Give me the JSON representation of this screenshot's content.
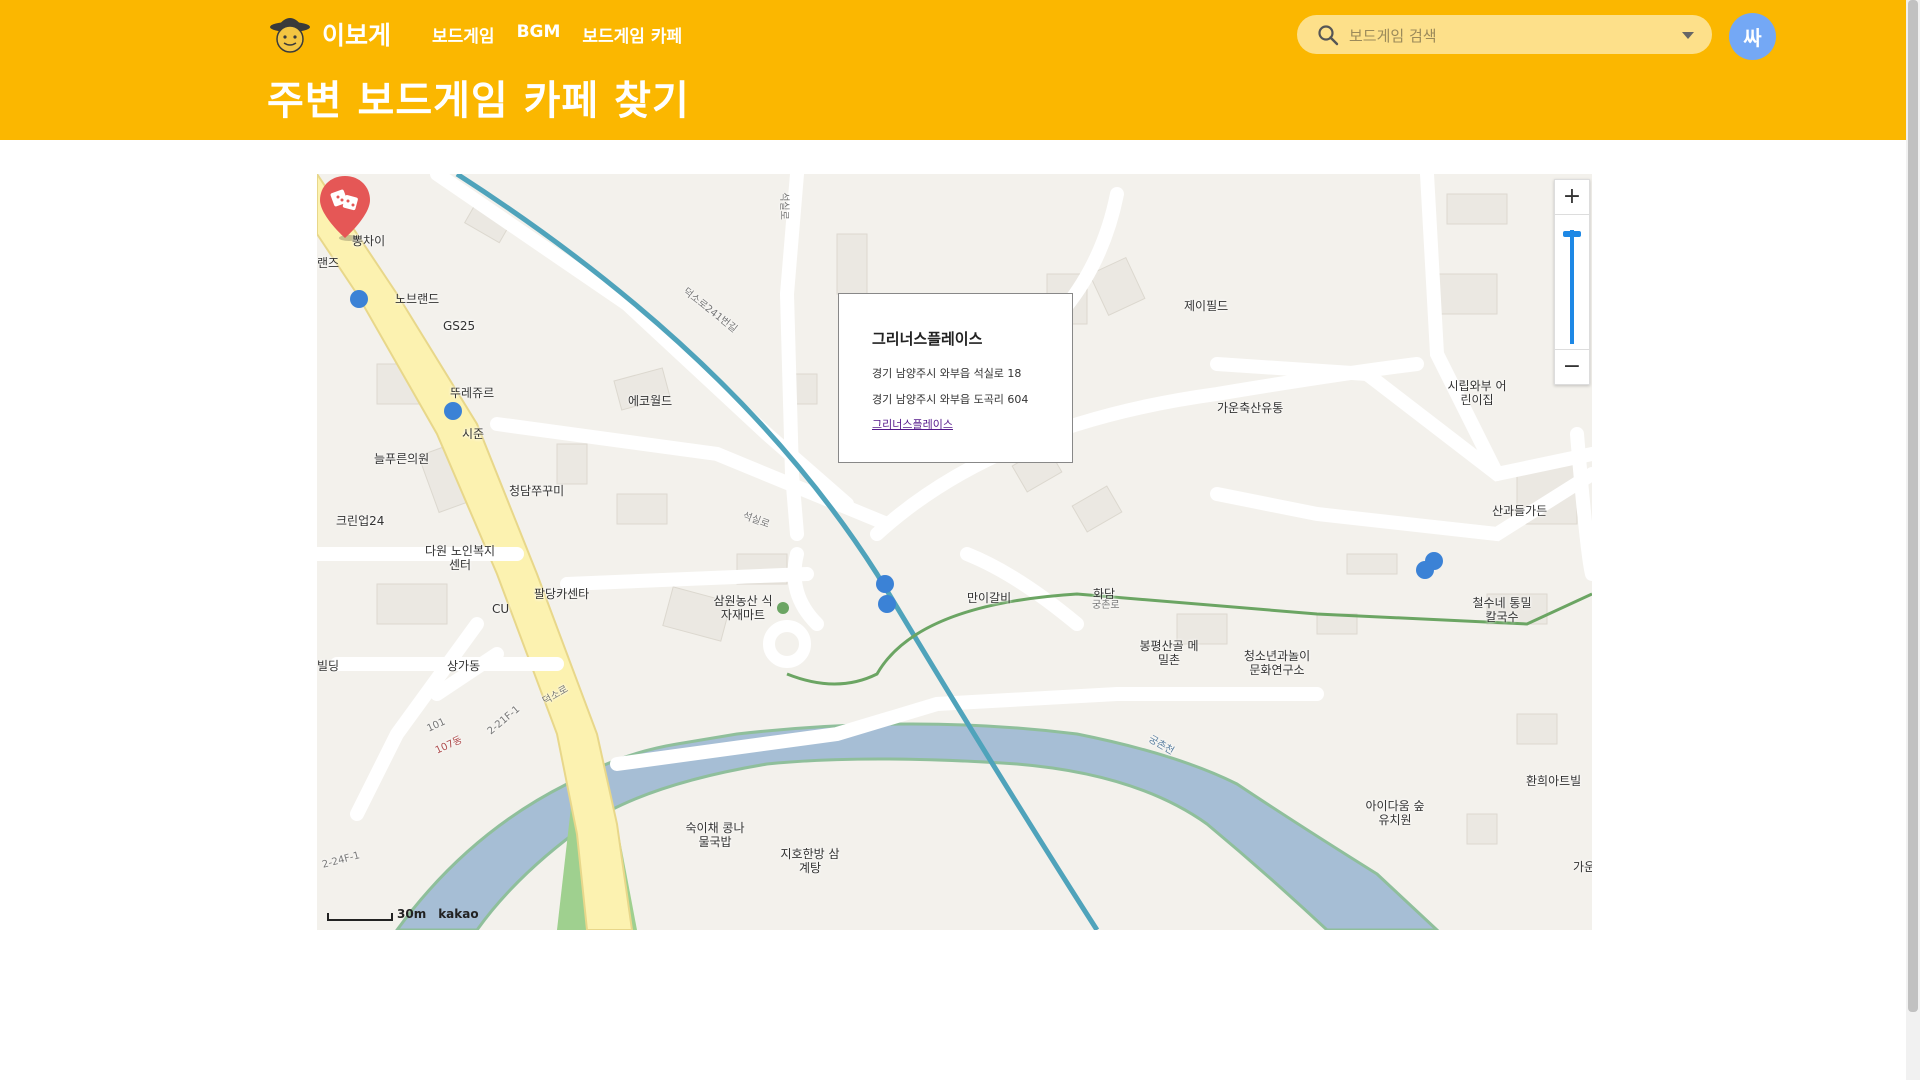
{
  "header": {
    "logo_text": "이보게",
    "nav": [
      "보드게임",
      "BGM",
      "보드게임 카페"
    ],
    "page_title": "주변 보드게임 카페 찾기",
    "search_placeholder": "보드게임 검색",
    "avatar_letter": "싸",
    "bg_color": "#fbb700"
  },
  "map": {
    "popup": {
      "name": "그리너스플레이스",
      "road_address": "경기 남양주시 와부읍 석실로 18",
      "jibun_address": "경기 남양주시 와부읍 도곡리 604",
      "link_text": "그리너스플레이스"
    },
    "zoom_in": "+",
    "zoom_out": "−",
    "scale_label": "30m",
    "provider": "kakao",
    "places": [
      "뽕차이",
      "노브랜드",
      "GS25",
      "뚜레쥬르",
      "시준",
      "늘푸른의원",
      "청담쭈꾸미",
      "크린업24",
      "다원 노인복지센터",
      "팔당카센타",
      "CU",
      "상가동",
      "빌딩",
      "에코월드",
      "삼원농산 식자재마트",
      "제이필드",
      "가운축산유통",
      "시립와부 어린이집",
      "산과들가든",
      "만이갈비",
      "화담",
      "철수네 통밀칼국수",
      "봉평산골 메밀촌",
      "청소년과놀이 문화연구소",
      "숙이채 콩나물국밥",
      "지호한방 삼계탕",
      "아이다움 숲유치원",
      "환희아트빌",
      "가운",
      "랜즈"
    ],
    "road_labels": [
      "석실로",
      "석실로",
      "덕소로241번길",
      "덕소로",
      "궁촌로",
      "궁촌천",
      "101",
      "107동",
      "2-21F-1",
      "2-24F-1"
    ]
  }
}
